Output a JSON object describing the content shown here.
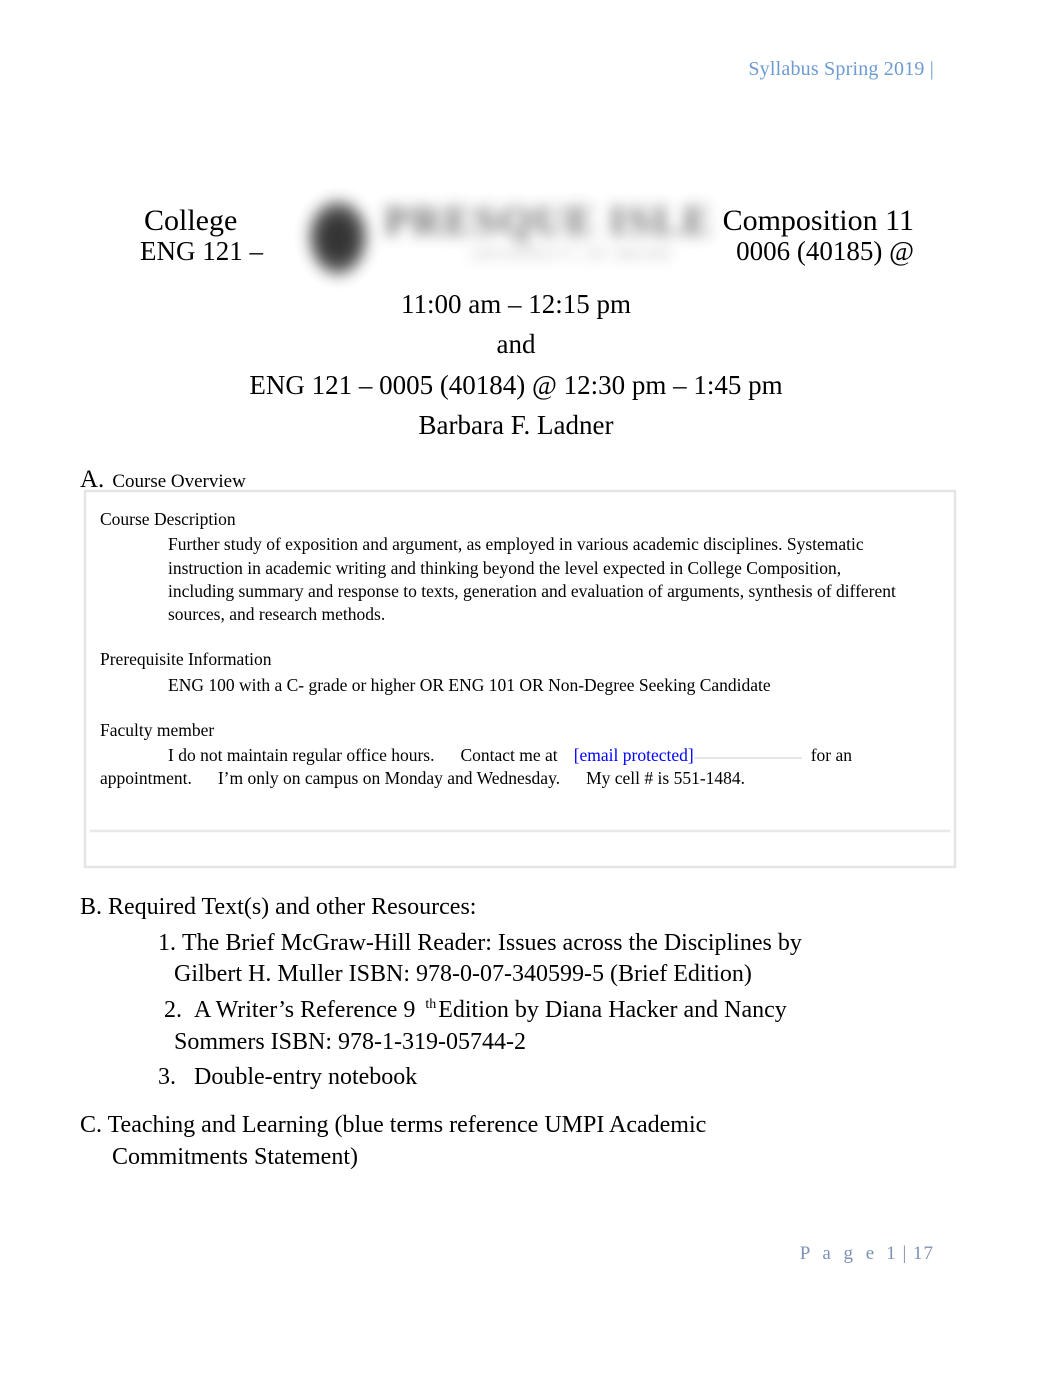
{
  "header": {
    "running_head": "Syllabus Spring 2019 |",
    "color": "#6c9bd2"
  },
  "title_block": {
    "left_title": "College",
    "right_title": "Composition 11",
    "logo": {
      "name": "university-logo",
      "wordmark": "PRESQUE ISLE",
      "subtext": "UNIVERSITY OF MAINE",
      "appearance": "blurred"
    },
    "course_left": "ENG 121 –",
    "course_right": "0006 (40185) @",
    "time_line": "11:00 am – 12:15 pm",
    "conjunction": "and",
    "second_section": "ENG 121 – 0005 (40184) @ 12:30 pm – 1:45 pm",
    "instructor": "Barbara F. Ladner"
  },
  "section_a": {
    "letter": "A.",
    "label": "Course Overview",
    "course_description": {
      "label": "Course Description",
      "body": "Further study of exposition and argument, as employed in various academic disciplines. Systematic instruction in academic writing and thinking beyond the level expected in College Composition, including summary and response to texts, generation and evaluation of arguments, synthesis of different sources, and research methods."
    },
    "prerequisite": {
      "label": "Prerequisite Information",
      "body": "ENG 100 with a C- grade or higher OR ENG 101 OR Non-Degree Seeking Candidate"
    },
    "faculty": {
      "label": "Faculty member",
      "office_hours": "I do not maintain regular office hours.",
      "contact_prefix": "Contact me at",
      "email": "[email protected]",
      "email_color": "#0000ff",
      "contact_suffix": "for an appointment.",
      "campus_days": "I’m only on campus on Monday and Wednesday.",
      "cell": "My cell # is 551-1484."
    }
  },
  "section_b": {
    "heading": "B. Required Text(s) and other Resources:",
    "items": [
      {
        "number": "1.",
        "line1": "The Brief  McGraw-Hill Reader:    Issues across the Disciplines      by",
        "line2": "Gilbert H. Muller ISBN: 978-0-07-340599-5 (Brief Edition)"
      },
      {
        "number": "2.",
        "title_pre": "A Writer’s Reference 9",
        "ordinal": "th",
        "title_post": "Edition  by Diana Hacker and Nancy",
        "line2": "Sommers ISBN: 978-1-319-05744-2"
      },
      {
        "number": "3.",
        "line1": "Double-entry notebook"
      }
    ]
  },
  "section_c": {
    "line1": "C. Teaching and Learning (blue terms reference UMPI Academic",
    "line2": "Commitments Statement)"
  },
  "footer": {
    "page_word": "P a g e",
    "page_numbers": "1 | 17",
    "color": "#7d92b4"
  }
}
